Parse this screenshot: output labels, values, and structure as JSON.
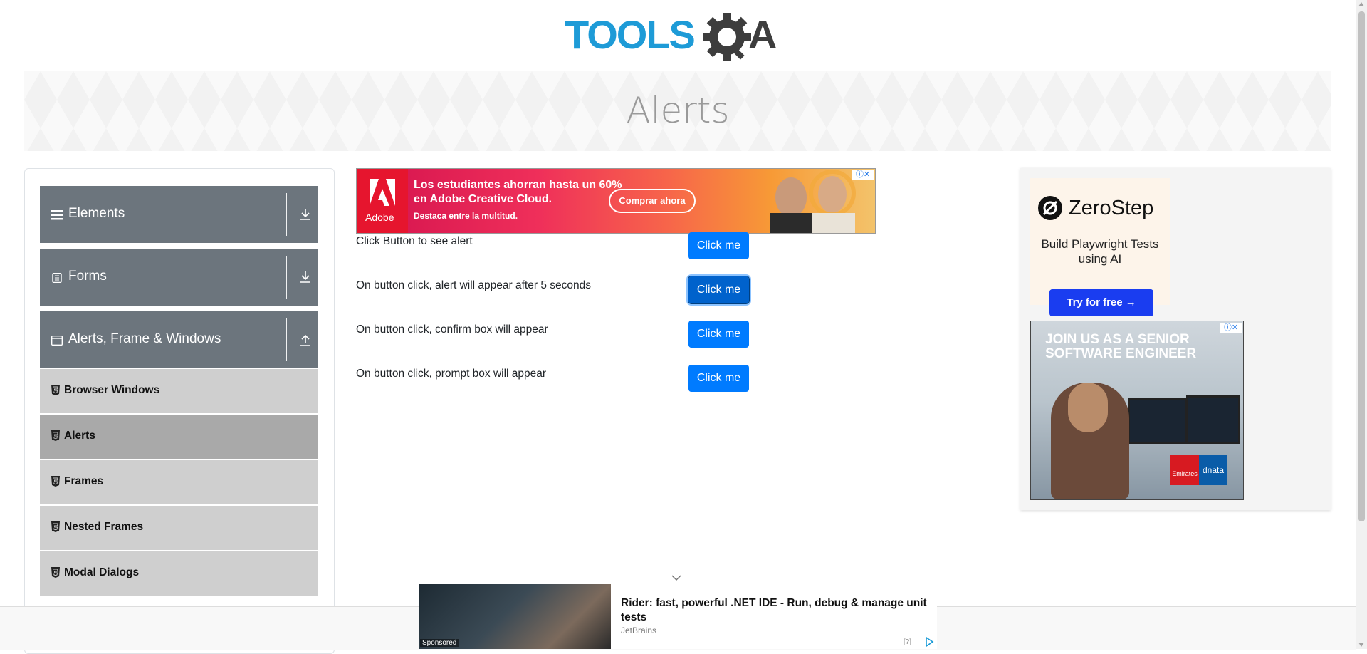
{
  "header": {
    "logo_alt": "TOOLSQA"
  },
  "banner": {
    "title": "Alerts"
  },
  "sidebar": {
    "groups": [
      {
        "label": "Elements",
        "icon": "hamburger-icon",
        "arrow": "download-arrow-icon"
      },
      {
        "label": "Forms",
        "icon": "document-icon",
        "arrow": "download-arrow-icon"
      },
      {
        "label": "Alerts, Frame & Windows",
        "icon": "window-icon",
        "arrow": "upload-arrow-icon"
      }
    ],
    "items": [
      {
        "label": "Browser Windows",
        "active": false
      },
      {
        "label": "Alerts",
        "active": true
      },
      {
        "label": "Frames",
        "active": false
      },
      {
        "label": "Nested Frames",
        "active": false
      },
      {
        "label": "Modal Dialogs",
        "active": false
      }
    ]
  },
  "main": {
    "rows": [
      {
        "label": "Click Button to see alert",
        "button": "Click me"
      },
      {
        "label": "On button click, alert will appear after 5 seconds",
        "button": "Click me"
      },
      {
        "label": "On button click, confirm box will appear",
        "button": "Click me"
      },
      {
        "label": "On button click, prompt box will appear",
        "button": "Click me"
      }
    ]
  },
  "ad_top": {
    "brand": "Adobe",
    "headline": "Los estudiantes ahorran hasta un 60% en Adobe Creative Cloud.",
    "subline": "Destaca entre la multitud.",
    "cta": "Comprar ahora"
  },
  "ad_right": {
    "zerostep": {
      "name": "ZeroStep",
      "tagline": "Build Playwright Tests using AI",
      "cta": "Try for free →"
    },
    "emirates": {
      "headline": "JOIN US AS A SENIOR SOFTWARE ENGINEER",
      "logo1": "Emirates",
      "logo2": "dnata"
    }
  },
  "ad_bottom": {
    "title": "Rider: fast, powerful .NET IDE - Run, debug & manage unit tests",
    "source": "JetBrains",
    "sponsored": "Sponsored",
    "info": "[?]"
  },
  "colors": {
    "accent": "#007bff",
    "sidebar_group": "#6c757d",
    "sidebar_item": "#cfcfcf",
    "sidebar_active": "#a9a9a9"
  }
}
